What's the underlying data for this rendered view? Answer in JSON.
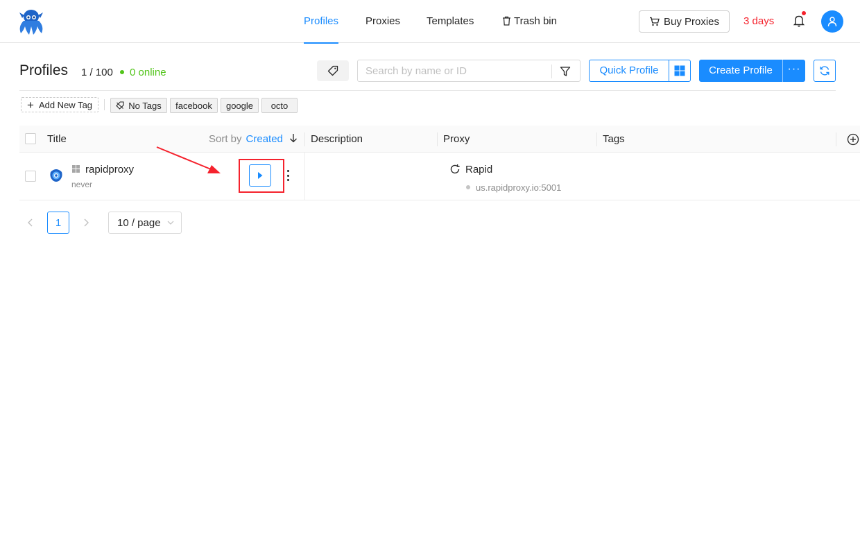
{
  "nav": {
    "tabs": [
      {
        "label": "Profiles",
        "active": true
      },
      {
        "label": "Proxies",
        "active": false
      },
      {
        "label": "Templates",
        "active": false
      },
      {
        "label": "Trash bin",
        "active": false
      }
    ],
    "buy_proxies_label": "Buy Proxies",
    "trial_days": "3 days"
  },
  "header": {
    "title": "Profiles",
    "count": "1 / 100",
    "online": "0 online",
    "search_placeholder": "Search by name or ID",
    "quick_profile_label": "Quick Profile",
    "create_profile_label": "Create Profile",
    "more_label": "···"
  },
  "tags": {
    "add_label": "Add New Tag",
    "no_tags_label": "No Tags",
    "items": [
      "facebook",
      "google",
      "octo"
    ]
  },
  "table": {
    "columns": {
      "title": "Title",
      "sort_by": "Sort by",
      "sort_field": "Created",
      "description": "Description",
      "proxy": "Proxy",
      "tags": "Tags"
    },
    "rows": [
      {
        "name": "rapidproxy",
        "last_run": "never",
        "os": "windows",
        "description": "",
        "proxy_name": "Rapid",
        "proxy_host": "us.rapidproxy.io:5001",
        "tags": ""
      }
    ]
  },
  "pagination": {
    "current_page": "1",
    "page_size": "10 / page"
  },
  "colors": {
    "accent": "#1a8cff",
    "danger": "#f5222d",
    "online": "#52c41a"
  }
}
